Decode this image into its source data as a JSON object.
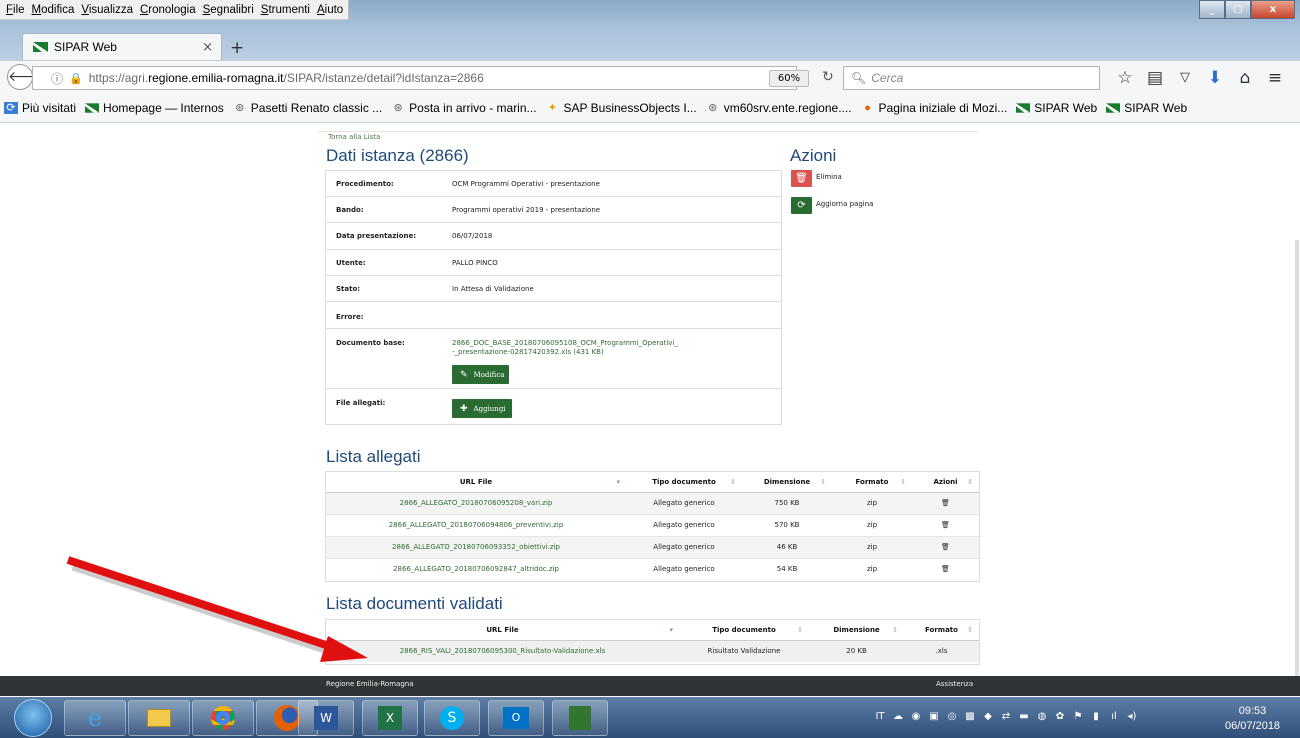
{
  "browser": {
    "menu": [
      "File",
      "Modifica",
      "Visualizza",
      "Cronologia",
      "Segnalibri",
      "Strumenti",
      "Aiuto"
    ],
    "window_buttons": {
      "minimize": "_",
      "maximize": "▢",
      "close": "x"
    },
    "tab_title": "SIPAR Web",
    "tab_close": "×",
    "new_tab": "+",
    "url_prefix": "https://agri.",
    "url_domain": "regione.emilia-romagna.it",
    "url_path": "/SIPAR/istanze/detail?idIstanza=2866",
    "zoom": "60%",
    "search_placeholder": "Cerca",
    "bookmarks": [
      {
        "label": "Più visitati",
        "icon": "most-visited-icon"
      },
      {
        "label": "Homepage — Internos",
        "icon": "regione-flag-icon"
      },
      {
        "label": "Pasetti Renato classic ...",
        "icon": "globe-icon"
      },
      {
        "label": "Posta in arrivo - marin...",
        "icon": "globe-icon"
      },
      {
        "label": "SAP BusinessObjects I...",
        "icon": "sap-icon"
      },
      {
        "label": "vm60srv.ente.regione....",
        "icon": "globe-icon"
      },
      {
        "label": "Pagina iniziale di Mozi...",
        "icon": "firefox-icon"
      },
      {
        "label": "SIPAR Web",
        "icon": "regione-flag-icon"
      },
      {
        "label": "SIPAR Web",
        "icon": "regione-flag-icon"
      }
    ]
  },
  "page": {
    "back_link": "Torna alla Lista",
    "dati_title": "Dati istanza (2866)",
    "azioni_title": "Azioni",
    "fields": [
      {
        "label": "Procedimento:",
        "value": "OCM Programmi Operativi - presentazione"
      },
      {
        "label": "Bando:",
        "value": "Programmi operativi 2019 - presentazione"
      },
      {
        "label": "Data presentazione:",
        "value": "06/07/2018"
      },
      {
        "label": "Utente:",
        "value": "PALLO PINCO"
      },
      {
        "label": "Stato:",
        "value": "In Attesa di Validazione"
      },
      {
        "label": "Errore:",
        "value": ""
      }
    ],
    "documento_base_label": "Documento base:",
    "documento_base_line1": "2866_DOC_BASE_20180706095108_OCM_Programmi_Operativi_",
    "documento_base_line2": "-_presentazione-02817420392.xls (431 KB)",
    "modifica_label": "Modifica",
    "file_allegati_label": "File allegati:",
    "aggiungi_label": "Aggiungi",
    "azioni": [
      {
        "label": "Elimina",
        "color": "#d9534f"
      },
      {
        "label": "Aggiorna pagina",
        "color": "#2a6b32"
      }
    ],
    "allegati_title": "Lista allegati",
    "allegati_headers": [
      "URL File",
      "Tipo documento",
      "Dimensione",
      "Formato",
      "Azioni"
    ],
    "allegati_rows": [
      [
        "2866_ALLEGATO_20180706095208_vari.zip",
        "Allegato generico",
        "750 KB",
        "zip"
      ],
      [
        "2866_ALLEGATO_20180706094806_preventivi.zip",
        "Allegato generico",
        "570 KB",
        "zip"
      ],
      [
        "2866_ALLEGATO_20180706093352_obiettivi.zip",
        "Allegato generico",
        "46 KB",
        "zip"
      ],
      [
        "2866_ALLEGATO_20180706092847_altridoc.zip",
        "Allegato generico",
        "54 KB",
        "zip"
      ]
    ],
    "validati_title": "Lista documenti validati",
    "validati_headers": [
      "URL File",
      "Tipo documento",
      "Dimensione",
      "Formato"
    ],
    "validati_rows": [
      [
        "2866_RIS_VALI_20180706095300_Risultato-Validazione.xls",
        "Risultato Validazione",
        "20 KB",
        ".xls"
      ]
    ],
    "footer_left": "Regione Emilia-Romagna",
    "footer_right": "Assistenza"
  },
  "taskbar": {
    "language": "IT",
    "time": "09:53",
    "date": "06/07/2018",
    "apps": [
      "ie-icon",
      "file-explorer-icon",
      "chrome-icon",
      "firefox-icon",
      "word-icon",
      "excel-icon",
      "skype-icon",
      "outlook-icon",
      "project-icon"
    ]
  },
  "colors": {
    "accent_green": "#2a6b32",
    "danger_red": "#d9534f",
    "heading_blue": "#1f4a7a",
    "arrow_red": "#e01010"
  }
}
